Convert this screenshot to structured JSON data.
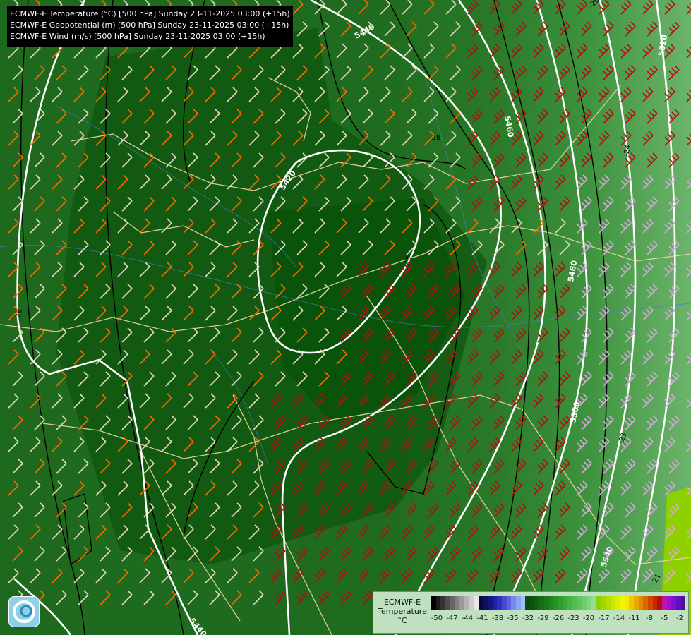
{
  "header": {
    "lines": [
      "ECMWF-E Temperature (°C) [500 hPa] Sunday 23-11-2025 03:00 (+15h)",
      "ECMWF-E Geopotential (m) [500 hPa] Sunday 23-11-2025 03:00 (+15h)",
      "ECMWF-E Wind (m/s) [500 hPa] Sunday 23-11-2025 03:00 (+15h)"
    ]
  },
  "contours": {
    "geopotential_labels": [
      "5440",
      "5420",
      "5460",
      "5480",
      "5500",
      "5520",
      "5540",
      "5440"
    ],
    "temperature_labels": [
      "-28",
      "-28",
      "-28",
      "-24",
      "-23",
      "-21",
      "-28"
    ]
  },
  "legend": {
    "title_lines": [
      "ECMWF-E",
      "Temperature",
      "°C"
    ],
    "ticks": [
      "-50",
      "-47",
      "-44",
      "-41",
      "-38",
      "-35",
      "-32",
      "-29",
      "-26",
      "-23",
      "-20",
      "-17",
      "-14",
      "-11",
      "-8",
      "-5",
      "-2"
    ],
    "colors": [
      "#000000",
      "#1a1a1a",
      "#333333",
      "#4d4d4d",
      "#666666",
      "#808080",
      "#999999",
      "#b3b3b3",
      "#cccccc",
      "#e6e6e6",
      "#0a0a3a",
      "#101060",
      "#161680",
      "#2020a0",
      "#3030c0",
      "#4a4ad0",
      "#6060e0",
      "#7a8ae8",
      "#8aa6f0",
      "#99c2f8",
      "#0a4a0a",
      "#0d550d",
      "#116111",
      "#156d15",
      "#1a791a",
      "#208520",
      "#279127",
      "#2f9d2f",
      "#38a838",
      "#43b343",
      "#4fbd4f",
      "#5cc55c",
      "#6ccd6c",
      "#7fd57f",
      "#93dc93",
      "#8fd000",
      "#a0d800",
      "#b4e000",
      "#c8e800",
      "#dcf000",
      "#f0f800",
      "#f8e800",
      "#f0c800",
      "#e8a800",
      "#e08800",
      "#d86800",
      "#d04800",
      "#c82800",
      "#b01010",
      "#c010b0",
      "#a010d0",
      "#8010d0",
      "#6010c0",
      "#4a10a0"
    ]
  }
}
